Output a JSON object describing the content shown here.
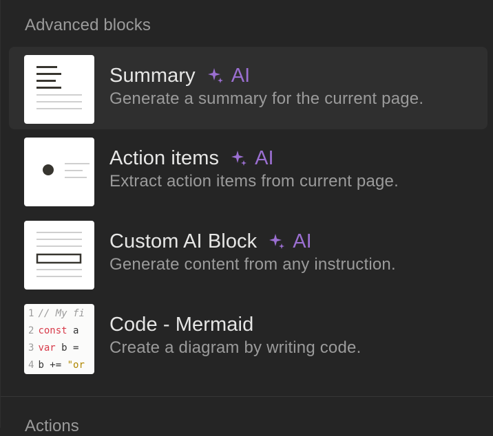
{
  "section": {
    "title": "Advanced blocks"
  },
  "items": [
    {
      "title": "Summary",
      "ai_label": "AI",
      "description": "Generate a summary for the current page.",
      "icon": "summary-block-thumbnail"
    },
    {
      "title": "Action items",
      "ai_label": "AI",
      "description": "Extract action items from current page.",
      "icon": "action-items-thumbnail"
    },
    {
      "title": "Custom AI Block",
      "ai_label": "AI",
      "description": "Generate content from any instruction.",
      "icon": "custom-ai-block-thumbnail"
    },
    {
      "title": "Code - Mermaid",
      "description": "Create a diagram by writing code.",
      "icon": "code-mermaid-thumbnail",
      "code_preview": [
        {
          "num": "1",
          "comment": "// My fi"
        },
        {
          "num": "2",
          "kw": "const",
          "rest": " a"
        },
        {
          "num": "3",
          "kw": "var",
          "rest": " b ="
        },
        {
          "num": "4",
          "rest": "b += ",
          "str": "\"or"
        }
      ]
    }
  ],
  "next_section": {
    "title": "Actions"
  },
  "colors": {
    "background": "#252525",
    "hover": "#2f2f2f",
    "title_text": "#e6e6e5",
    "muted_text": "#9b9b9b",
    "ai_accent": "#9b6fd1"
  }
}
